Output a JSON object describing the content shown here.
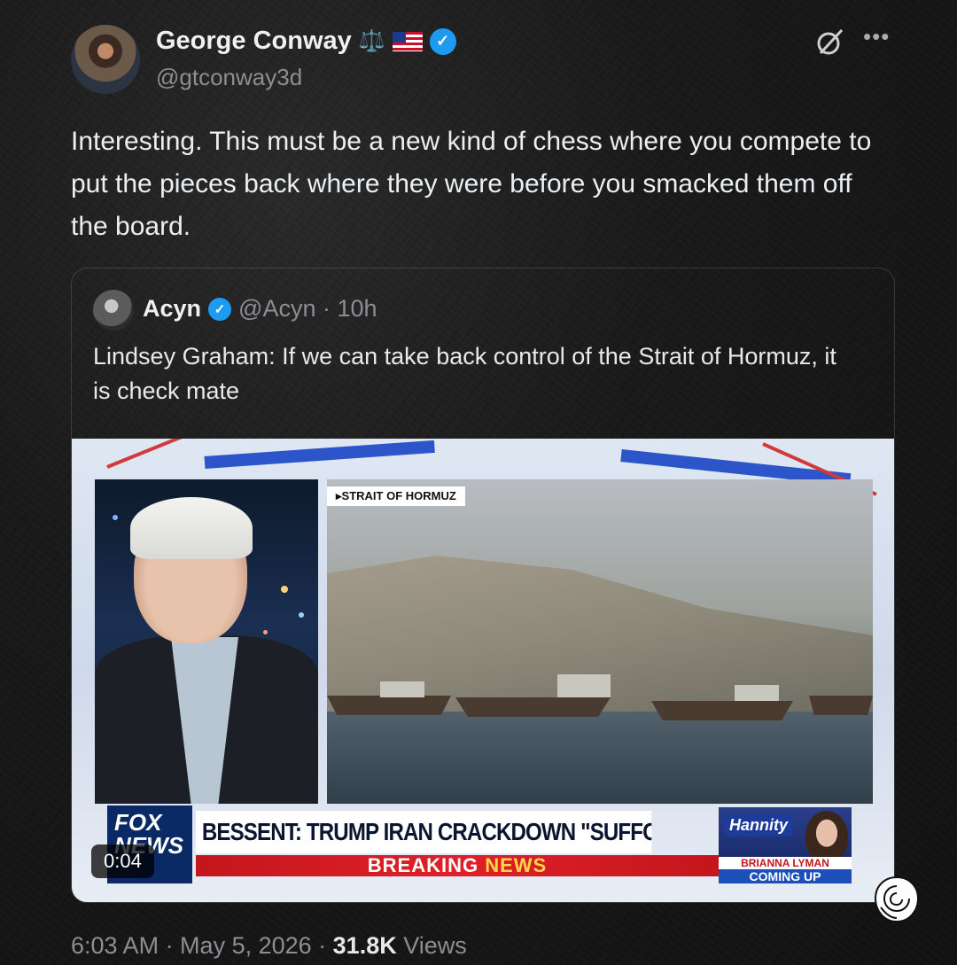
{
  "author": {
    "name": "George Conway",
    "handle": "@gtconway3d",
    "badges": [
      "scales-icon",
      "us-flag-icon",
      "verified-icon"
    ]
  },
  "tweet": {
    "text": "Interesting.   This must be a new kind of chess where you compete to put the pieces back where they were before you smacked them off the board."
  },
  "quoted": {
    "name": "Acyn",
    "handle_time": "@Acyn · 10h",
    "text": "Lindsey Graham: If we can take back control of the Strait of Hormuz, it is check mate",
    "video": {
      "location_tag": "▸STRAIT OF HORMUZ",
      "headline": "BESSENT: TRUMP IRAN CRACKDOWN \"SUFFOCATING\" REGIME",
      "breaking_prefix": "BREAKING",
      "breaking_suffix": "NEWS",
      "network_line1": "FOX",
      "network_line2": "NEWS",
      "show": "Hannity",
      "promo_name": "BRIANNA LYMAN",
      "promo_status": "COMING UP",
      "duration": "0:04"
    }
  },
  "footer": {
    "time": "6:03 AM · May 5, 2026 · ",
    "views_count": "31.8K",
    "views_label": " Views"
  },
  "colors": {
    "verified": "#1d9bf0",
    "fox_red": "#c4161c",
    "fox_blue": "#0a2a66"
  }
}
